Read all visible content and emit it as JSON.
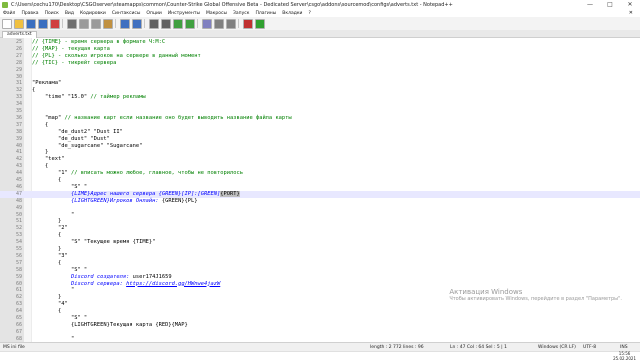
{
  "window": {
    "title": "C:\\Users\\cechu170\\Desktop\\CSGOserver\\steamapps\\common\\Counter-Strike Global Offensive Beta - Dedicated Server\\csgo\\addons\\sourcemod\\configs\\adverts.txt - Notepad++",
    "minimize": "—",
    "maximize": "□",
    "close": "✕"
  },
  "menu": [
    "Файл",
    "Правка",
    "Поиск",
    "Вид",
    "Кодировки",
    "Синтаксисы",
    "Опции",
    "Инструменты",
    "Макросы",
    "Запуск",
    "Плагины",
    "Вкладки",
    "?"
  ],
  "menu_close": "✕",
  "tab": {
    "label": "adverts.txt"
  },
  "lines": [
    {
      "n": "25",
      "html": "<span class=\"c-com\">// {TIME} - время сервера в формате Ч:М:С</span>"
    },
    {
      "n": "26",
      "html": "<span class=\"c-com\">// {MAP} - текущая карта</span>"
    },
    {
      "n": "27",
      "html": "<span class=\"c-com\">// {PL} - сколько игроков на сервере в данный момент</span>"
    },
    {
      "n": "28",
      "html": "<span class=\"c-com\">// {TIC} - тикрейт сервера</span>"
    },
    {
      "n": "29",
      "html": ""
    },
    {
      "n": "30",
      "html": ""
    },
    {
      "n": "31",
      "html": "\"Реклама\""
    },
    {
      "n": "32",
      "html": "{"
    },
    {
      "n": "33",
      "html": "    \"time\" \"15.0\" <span class=\"c-com\">// таймер рекламы</span>"
    },
    {
      "n": "34",
      "html": ""
    },
    {
      "n": "35",
      "html": ""
    },
    {
      "n": "36",
      "html": "    \"map\" <span class=\"c-com\">// название карт если название оно будет выводить название файла карты</span>"
    },
    {
      "n": "37",
      "html": "    {"
    },
    {
      "n": "38",
      "html": "        \"de_dust2\" \"Dust II\""
    },
    {
      "n": "39",
      "html": "        \"de_dust\" \"Dust\""
    },
    {
      "n": "40",
      "html": "        \"de_sugarcane\" \"Sugarcane\""
    },
    {
      "n": "41",
      "html": "    }"
    },
    {
      "n": "42",
      "html": "    \"text\""
    },
    {
      "n": "43",
      "html": "    {"
    },
    {
      "n": "44",
      "html": "        \"1\" <span class=\"c-com\">// вписать можно любое, главное, чтобы не повторилось</span>"
    },
    {
      "n": "45",
      "html": "        {"
    },
    {
      "n": "46",
      "html": "            \"S\" \""
    },
    {
      "n": "47",
      "html": "            <span class=\"c-ital\">{LIME}Адрес нашего сервера {GREEN}[IP]:[GREEN]</span><span class=\"c-hl\">{PORT}</span>",
      "current": true
    },
    {
      "n": "48",
      "html": "            <span class=\"c-ital\">{LIGHTGREEN}Игроков Онлайн:</span> {GREEN}{PL}"
    },
    {
      "n": "49",
      "html": ""
    },
    {
      "n": "50",
      "html": "            \""
    },
    {
      "n": "51",
      "html": "        }"
    },
    {
      "n": "52",
      "html": "        \"2\""
    },
    {
      "n": "53",
      "html": "        {"
    },
    {
      "n": "54",
      "html": "            \"S\" \"Текущее время {TIME}\""
    },
    {
      "n": "55",
      "html": "        }"
    },
    {
      "n": "56",
      "html": "        \"3\""
    },
    {
      "n": "57",
      "html": "        {"
    },
    {
      "n": "58",
      "html": "            \"S\" \""
    },
    {
      "n": "59",
      "html": "            <span class=\"c-ital\">Discord создателя:</span> user174J1659"
    },
    {
      "n": "60",
      "html": "            <span class=\"c-ital\">Discord сервера:</span> <span class=\"c-link\">https://discord.gg/HWnwe4jazW</span>"
    },
    {
      "n": "61",
      "html": "            \""
    },
    {
      "n": "62",
      "html": "        }"
    },
    {
      "n": "63",
      "html": "        \"4\""
    },
    {
      "n": "64",
      "html": "        {"
    },
    {
      "n": "65",
      "html": "            \"S\" \""
    },
    {
      "n": "66",
      "html": "            {LIGHTGREEN}Текущая карта {RED}{MAP}"
    },
    {
      "n": "67",
      "html": ""
    },
    {
      "n": "68",
      "html": "            \""
    }
  ],
  "watermark": {
    "line1": "Активация Windows",
    "line2": "Чтобы активировать Windows, перейдите в раздел \"Параметры\"."
  },
  "status": {
    "type": "MS ini file",
    "length": "length : 2 772   lines : 96",
    "position": "Ln : 47   Col : 64   Sel : 5 | 1",
    "eol": "Windows (CR LF)",
    "encoding": "UTF-8",
    "mode": "INS"
  },
  "taskbar": {
    "time": "15:56",
    "date": "25.02.2021"
  },
  "colors": {
    "comment": "#008000",
    "keyword_italic": "#0000ff",
    "gutter": "#e4e4e4",
    "current_line": "#e8e8ff"
  },
  "icons": [
    "new-file-icon",
    "open-icon",
    "save-icon",
    "save-all-icon",
    "close-icon",
    "print-icon",
    "cut-icon",
    "copy-icon",
    "paste-icon",
    "undo-icon",
    "redo-icon",
    "find-icon",
    "replace-icon",
    "zoom-in-icon",
    "zoom-out-icon",
    "sync-icon",
    "wrap-icon",
    "indent-guide-icon",
    "macro-record-icon",
    "macro-play-icon"
  ]
}
